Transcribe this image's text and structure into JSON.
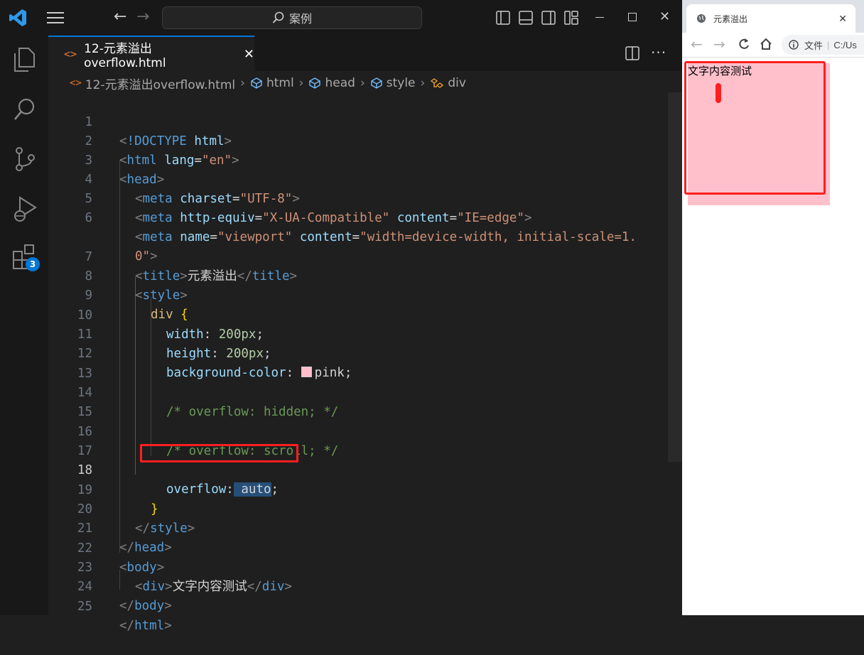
{
  "titlebar": {
    "search_text": "案例"
  },
  "activity_bar": {
    "extensions_badge": "3"
  },
  "tab": {
    "filename": "12-元素溢出overflow.html",
    "icon": "html-file-icon"
  },
  "breadcrumb": {
    "items": [
      "12-元素溢出overflow.html",
      "html",
      "head",
      "style",
      "div"
    ]
  },
  "code": {
    "active_line": 18,
    "color_swatch": "#ffc0cb",
    "lines": [
      {
        "n": "1"
      },
      {
        "n": "2"
      },
      {
        "n": "3"
      },
      {
        "n": "4"
      },
      {
        "n": "5"
      },
      {
        "n": "6"
      },
      {
        "n": ""
      },
      {
        "n": "7"
      },
      {
        "n": "8"
      },
      {
        "n": "9"
      },
      {
        "n": "10"
      },
      {
        "n": "11"
      },
      {
        "n": "12"
      },
      {
        "n": "13"
      },
      {
        "n": "14"
      },
      {
        "n": "15"
      },
      {
        "n": "16"
      },
      {
        "n": "17"
      },
      {
        "n": "18"
      },
      {
        "n": "19"
      },
      {
        "n": "20"
      },
      {
        "n": "21"
      },
      {
        "n": "22"
      },
      {
        "n": "23"
      },
      {
        "n": "24"
      },
      {
        "n": "25"
      }
    ],
    "t": {
      "doctype": "!DOCTYPE",
      "html": "html",
      "lang": "lang",
      "en": "\"en\"",
      "head": "head",
      "meta": "meta",
      "charset": "charset",
      "utf8": "\"UTF-8\"",
      "http_equiv": "http-equiv",
      "xua": "\"X-UA-Compatible\"",
      "content": "content",
      "ieedge": "\"IE=edge\"",
      "name": "name",
      "viewport": "\"viewport\"",
      "viewport_content_a": "\"width=device-width, initial-scale=1.",
      "viewport_content_b": "0\"",
      "title": "title",
      "title_text": "元素溢出",
      "style": "style",
      "div": "div",
      "width": "width",
      "height": "height",
      "px200": "200px",
      "bgcolor": "background-color",
      "pink": "pink",
      "cmt_hidden": "/* overflow: hidden; */",
      "cmt_scroll": "/* overflow: scroll; */",
      "overflow": "overflow",
      "auto": "auto",
      "body": "body",
      "div_text": "文字内容测试"
    }
  },
  "browser": {
    "tab_title": "元素溢出",
    "address_label": "文件",
    "address_url": "C:/Us",
    "div_text": "文字内容测试"
  },
  "colors": {
    "vscode_accent": "#0078d4",
    "annotation_red": "#ff1f1f",
    "div_bg": "#ffc0cb"
  }
}
